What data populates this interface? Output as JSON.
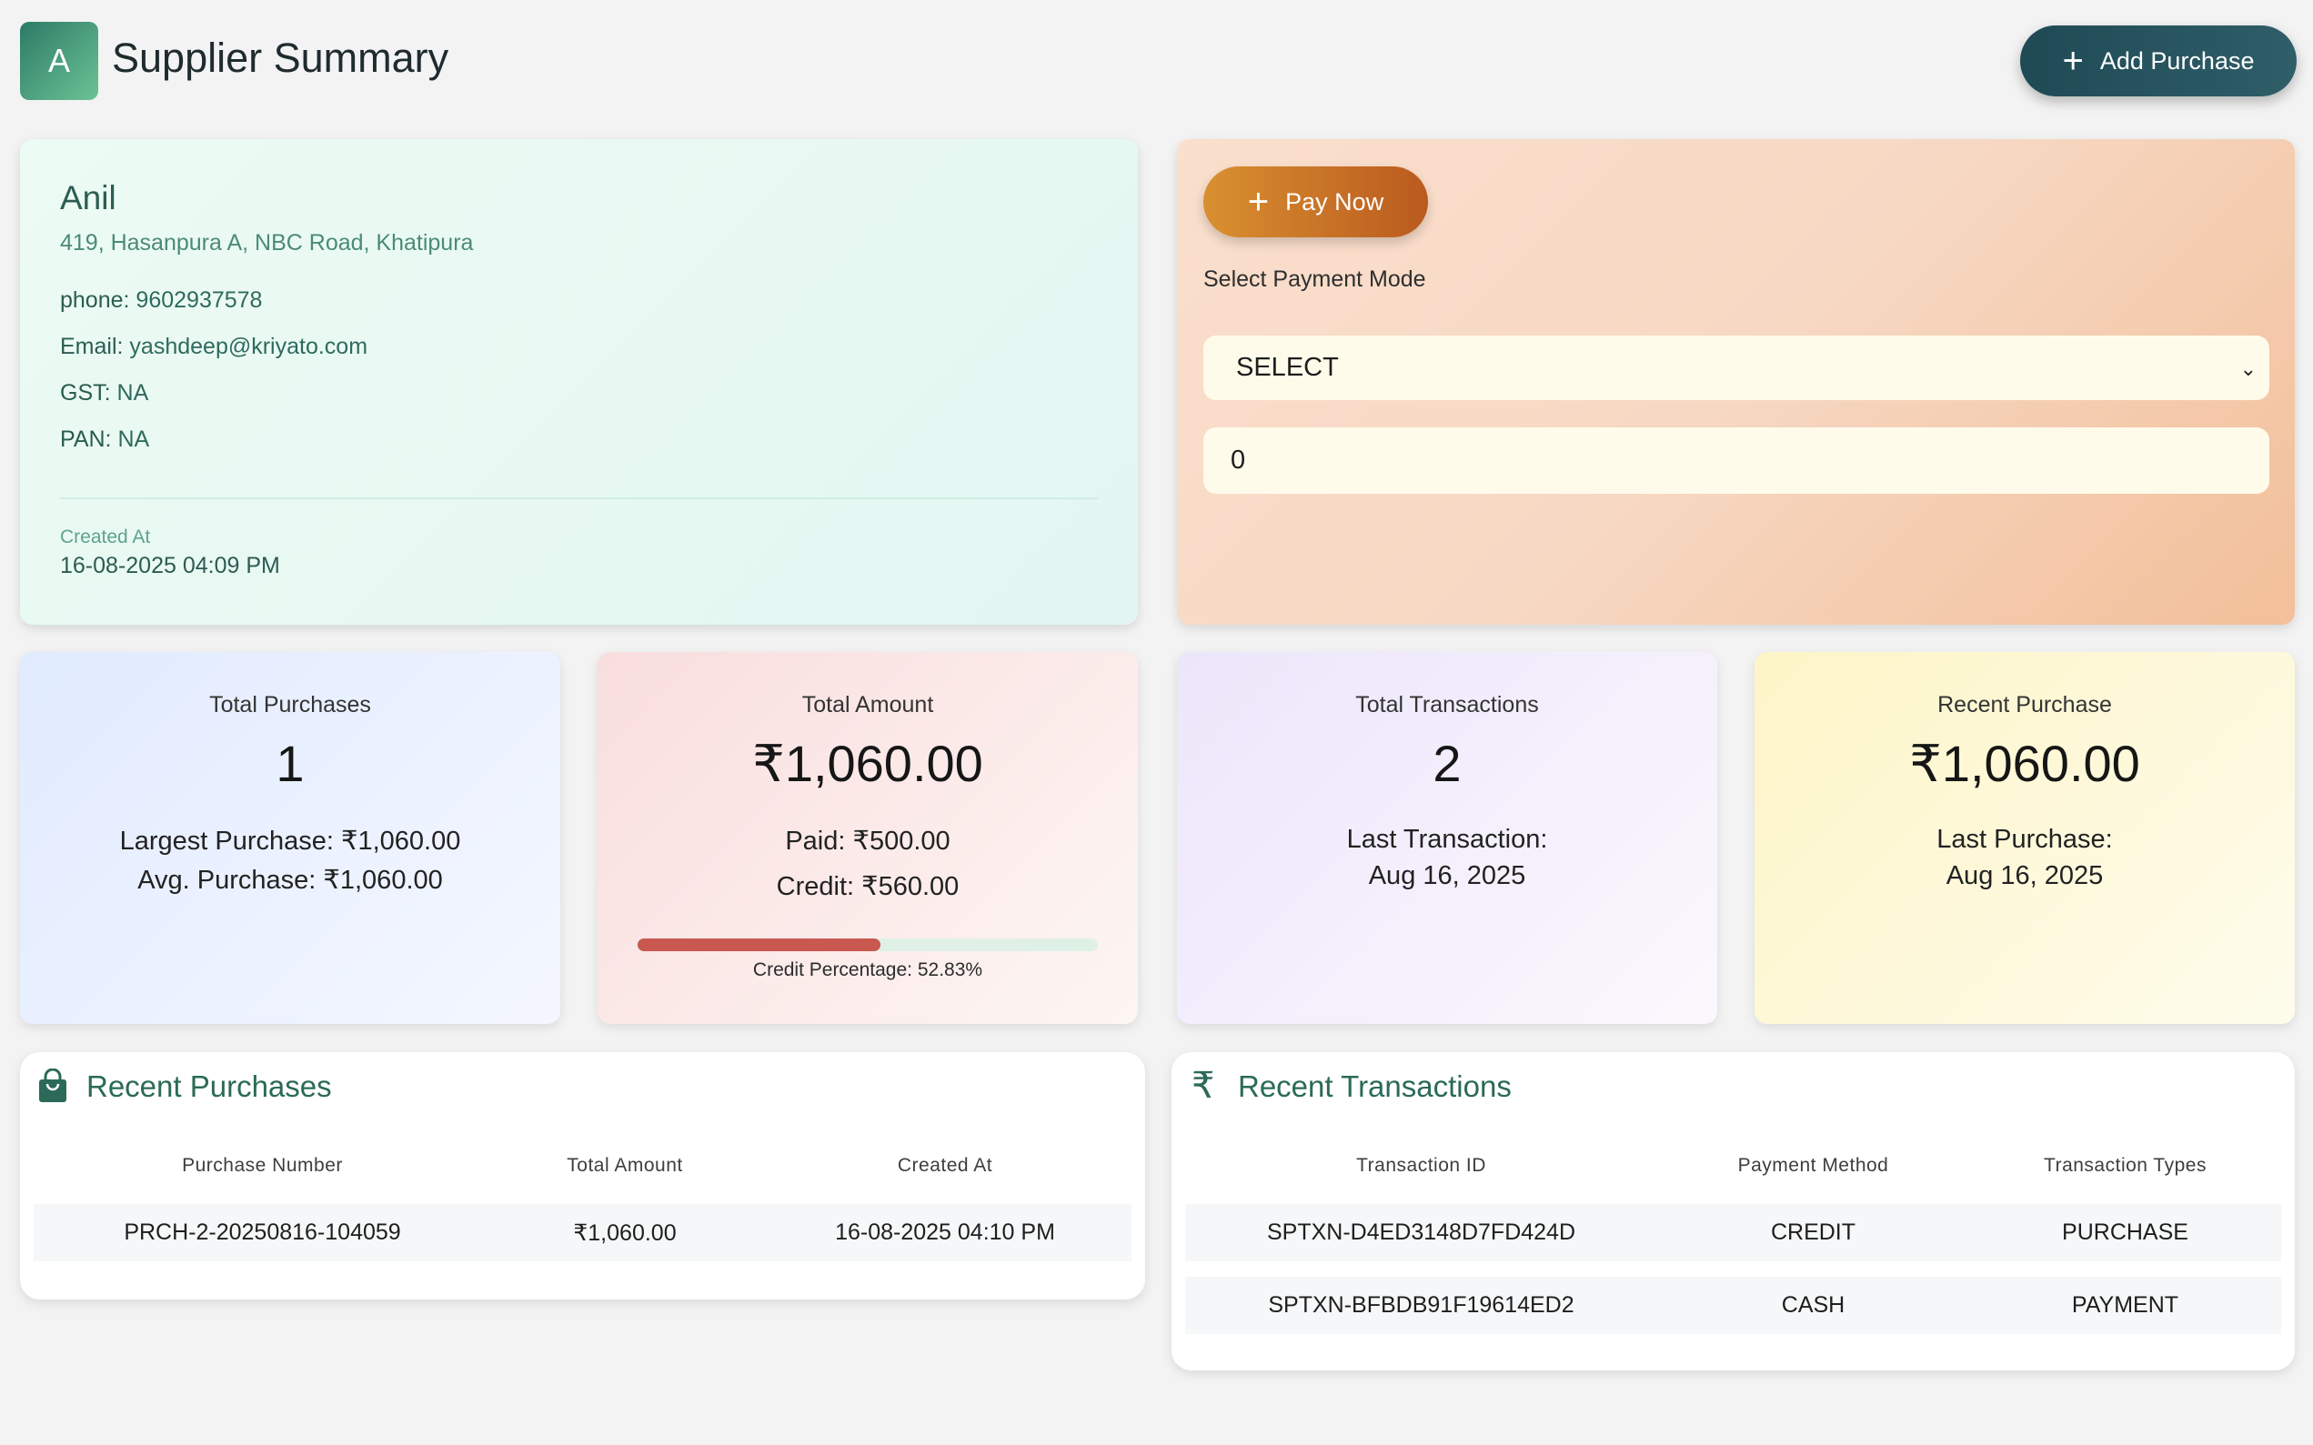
{
  "header": {
    "avatar_letter": "A",
    "title": "Supplier Summary",
    "add_purchase_label": "Add Purchase"
  },
  "supplier": {
    "name": "Anil",
    "address": "419, Hasanpura A, NBC Road, Khatipura",
    "phone_label": "phone:",
    "phone": "9602937578",
    "email_label": "Email:",
    "email": "yashdeep@kriyato.com",
    "gst_label": "GST:",
    "gst": "NA",
    "pan_label": "PAN:",
    "pan": "NA",
    "created_label": "Created At",
    "created_value": "16-08-2025 04:09 PM"
  },
  "payment": {
    "pay_now_label": "Pay Now",
    "mode_label": "Select Payment Mode",
    "mode_selected": "SELECT",
    "amount_value": "0"
  },
  "stats": {
    "purchases": {
      "title": "Total Purchases",
      "value": "1",
      "largest_label": "Largest Purchase:",
      "largest_value": "₹1,060.00",
      "avg_label": "Avg. Purchase:",
      "avg_value": "₹1,060.00"
    },
    "amount": {
      "title": "Total Amount",
      "value": "₹1,060.00",
      "paid_label": "Paid:",
      "paid_value": "₹500.00",
      "credit_label": "Credit:",
      "credit_value": "₹560.00",
      "credit_pct_label": "Credit Percentage:",
      "credit_pct_value": "52.83%",
      "credit_fraction": 0.5283
    },
    "transactions": {
      "title": "Total Transactions",
      "value": "2",
      "last_label": "Last Transaction:",
      "last_value": "Aug 16, 2025"
    },
    "recent": {
      "title": "Recent Purchase",
      "value": "₹1,060.00",
      "last_label": "Last Purchase:",
      "last_value": "Aug 16, 2025"
    }
  },
  "recent_purchases": {
    "title": "Recent Purchases",
    "icon": "shopping-bag-icon",
    "columns": [
      "Purchase Number",
      "Total Amount",
      "Created At"
    ],
    "rows": [
      [
        "PRCH-2-20250816-104059",
        "₹1,060.00",
        "16-08-2025 04:10 PM"
      ]
    ]
  },
  "recent_transactions": {
    "title": "Recent Transactions",
    "icon": "rupee-icon",
    "columns": [
      "Transaction ID",
      "Payment Method",
      "Transaction Types"
    ],
    "rows": [
      [
        "SPTXN-D4ED3148D7FD424D",
        "CREDIT",
        "PURCHASE"
      ],
      [
        "SPTXN-BFBDB91F19614ED2",
        "CASH",
        "PAYMENT"
      ]
    ]
  },
  "colors": {
    "primary_dark": "#1f4a55",
    "pay_orange": "#d99030",
    "accent_green": "#2b6a58",
    "credit_red": "#c85850"
  }
}
